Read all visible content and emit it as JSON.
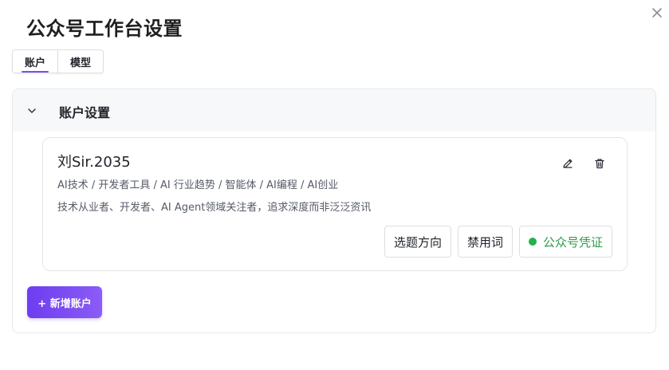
{
  "dialog": {
    "title": "公众号工作台设置"
  },
  "tabs": [
    {
      "label": "账户",
      "active": true
    },
    {
      "label": "模型",
      "active": false
    }
  ],
  "section": {
    "title": "账户设置",
    "expanded": true
  },
  "account": {
    "name": "刘Sir.2035",
    "tags": "AI技术 / 开发者工具 / AI 行业趋势 / 智能体 / AI编程 / AI创业",
    "description": "技术从业者、开发者、AI Agent领域关注者，追求深度而非泛泛资讯",
    "actions": {
      "topic_direction": "选题方向",
      "banned_words": "禁用词",
      "credential": "公众号凭证"
    },
    "credential_status_color": "#22b24c"
  },
  "add_account_label": "+ 新增账户",
  "colors": {
    "accent": "#7b4df2",
    "success": "#2c9c4a"
  },
  "icons": {
    "close": "close-icon",
    "chevron": "chevron-down-icon",
    "edit": "pencil-icon",
    "delete": "trash-icon"
  }
}
